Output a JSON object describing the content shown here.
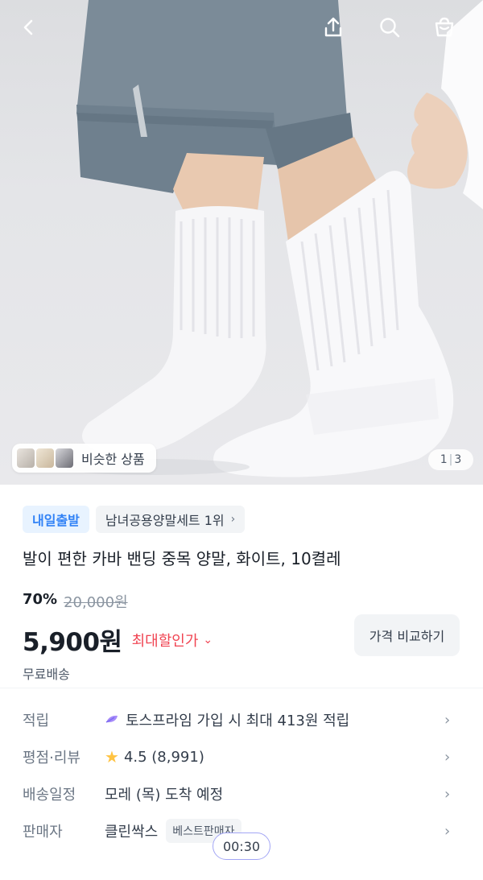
{
  "topbar": {
    "back_icon": "chevron-left-icon",
    "share_icon": "share-icon",
    "search_icon": "search-icon",
    "cart_icon": "shopping-bag-icon"
  },
  "hero": {
    "similar_label": "비슷한 상품",
    "page_current": "1",
    "page_total": "3"
  },
  "badges": {
    "delivery": "내일출발",
    "ranking": "남녀공용양말세트 1위"
  },
  "product": {
    "title": "발이 편한 카바 밴딩 중목 양말, 화이트, 10켤레",
    "discount": "70%",
    "original_price": "20,000원",
    "price": "5,900원",
    "max_discount_label": "최대할인가",
    "compare_button": "가격 비교하기",
    "shipping": "무료배송"
  },
  "details": [
    {
      "label": "적립",
      "value": "토스프라임 가입 시 최대 413원 적립"
    },
    {
      "label": "평점·리뷰",
      "value": "4.5 (8,991)"
    },
    {
      "label": "배송일정",
      "value": "모레 (목) 도착 예정"
    },
    {
      "label": "판매자",
      "value": "클린싹스",
      "badge": "베스트판매자"
    }
  ],
  "timer": "00:30",
  "colors": {
    "accent_blue": "#3182f6",
    "discount_red": "#f04452",
    "star": "#ffc342"
  }
}
